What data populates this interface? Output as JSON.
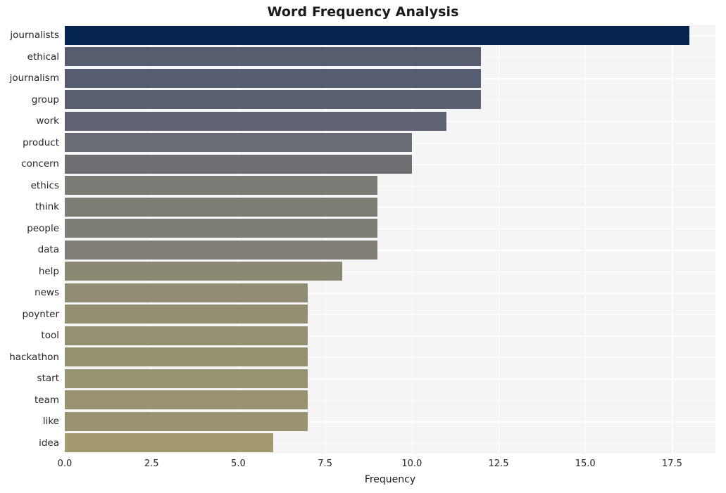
{
  "chart_data": {
    "type": "bar",
    "orientation": "horizontal",
    "title": "Word Frequency Analysis",
    "xlabel": "Frequency",
    "ylabel": "",
    "categories": [
      "journalists",
      "ethical",
      "journalism",
      "group",
      "work",
      "product",
      "concern",
      "ethics",
      "think",
      "people",
      "data",
      "help",
      "news",
      "poynter",
      "tool",
      "hackathon",
      "start",
      "team",
      "like",
      "idea"
    ],
    "values": [
      18,
      12,
      12,
      12,
      11,
      10,
      10,
      9,
      9,
      9,
      9,
      8,
      7,
      7,
      7,
      7,
      7,
      7,
      7,
      6
    ],
    "bar_colors": [
      "#05254f",
      "#575c6f",
      "#575d70",
      "#5a5f71",
      "#5f6373",
      "#6a6c73",
      "#6c6e74",
      "#7b7a75",
      "#7d7c75",
      "#7e7d75",
      "#807e75",
      "#8b8874",
      "#918d73",
      "#948f72",
      "#959071",
      "#969171",
      "#979271",
      "#989271",
      "#999371",
      "#a49a6f"
    ],
    "xlim": [
      0,
      18.75
    ],
    "xticks": [
      0.0,
      2.5,
      5.0,
      7.5,
      10.0,
      12.5,
      15.0,
      17.5
    ],
    "xtick_labels": [
      "0.0",
      "2.5",
      "5.0",
      "7.5",
      "10.0",
      "12.5",
      "15.0",
      "17.5"
    ],
    "grid": true,
    "grid_color": "#ffffff",
    "plot_background": "#f5f5f5",
    "figure_background": "#ffffff",
    "legend": null,
    "style": "seaborn-whitegrid"
  }
}
